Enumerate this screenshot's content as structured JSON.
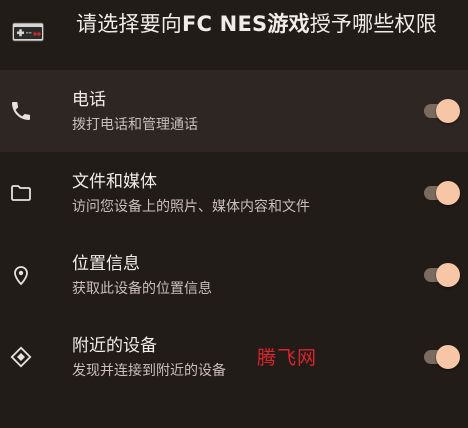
{
  "header": {
    "title_prefix": "请选择要向",
    "title_app": "FC NES游戏",
    "title_suffix": "授予哪些权限",
    "app_icon": "nes-controller-icon"
  },
  "permissions": [
    {
      "label": "电话",
      "desc": "拨打电话和管理通话",
      "icon": "phone-icon",
      "enabled": true
    },
    {
      "label": "文件和媒体",
      "desc": "访问您设备上的照片、媒体内容和文件",
      "icon": "folder-icon",
      "enabled": true
    },
    {
      "label": "位置信息",
      "desc": "获取此设备的位置信息",
      "icon": "location-pin-icon",
      "enabled": true
    },
    {
      "label": "附近的设备",
      "desc": "发现并连接到附近的设备",
      "icon": "nearby-devices-icon",
      "enabled": true
    }
  ],
  "watermark": "腾飞网",
  "colors": {
    "background": "#221c18",
    "highlight_row": "#2d2622",
    "toggle_thumb": "#f6c6a7",
    "toggle_track": "#7a6a60",
    "watermark": "#d8262c"
  }
}
